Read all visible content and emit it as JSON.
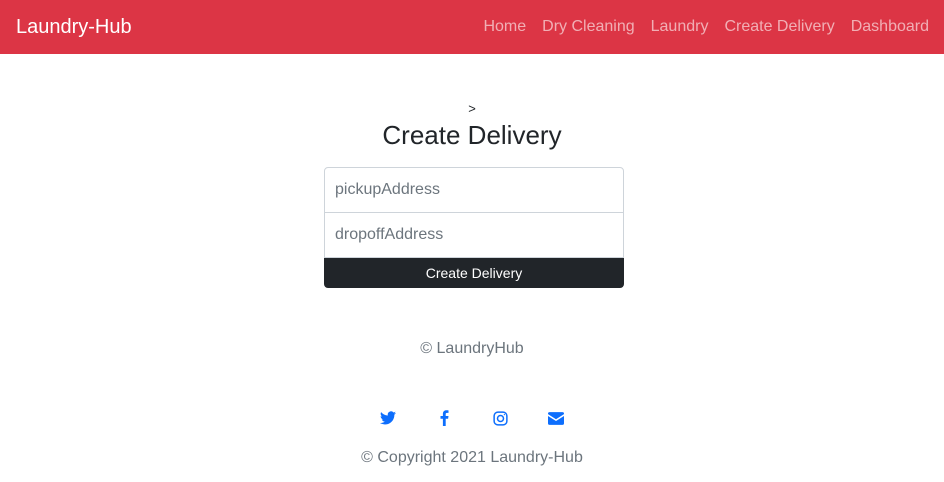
{
  "navbar": {
    "brand": "Laundry-Hub",
    "links": [
      "Home",
      "Dry Cleaning",
      "Laundry",
      "Create Delivery",
      "Dashboard"
    ]
  },
  "breadcrumb": ">",
  "page_title": "Create Delivery",
  "form": {
    "pickup_placeholder": "pickupAddress",
    "dropoff_placeholder": "dropoffAddress",
    "submit_label": "Create Delivery"
  },
  "footer": {
    "brand": "© LaundryHub",
    "social_icons": [
      "twitter-icon",
      "facebook-icon",
      "instagram-icon",
      "envelope-icon"
    ],
    "copyright": "© Copyright 2021 Laundry-Hub"
  },
  "colors": {
    "navbar_bg": "#dc3545",
    "button_bg": "#212529",
    "social_icon": "#0d6efd",
    "muted_text": "#6c757d"
  }
}
